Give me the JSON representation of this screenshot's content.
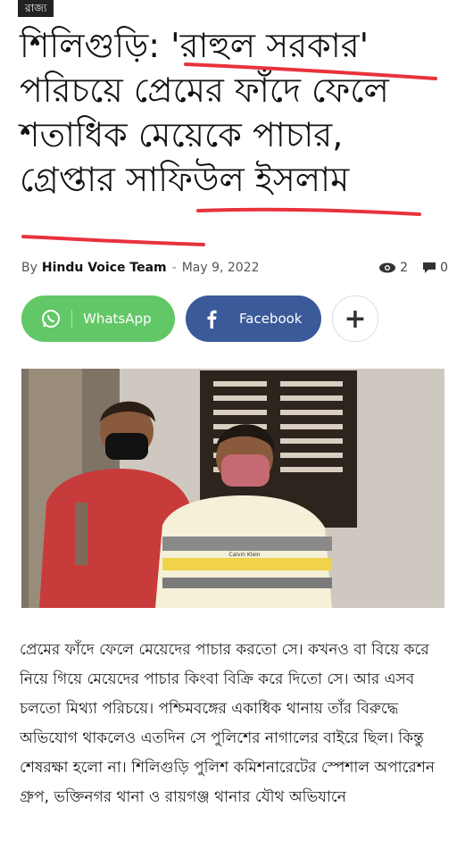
{
  "category": "রাজ্য",
  "title": "শিলিগুড়ি: 'রাহুল সরকার' পরিচয়ে প্রেমের ফাঁদে ফেলে শতাধিক মেয়েকে পাচার, গ্রেপ্তার সাফিউল ইসলাম",
  "meta": {
    "by": "By",
    "author": "Hindu Voice Team",
    "separator": "-",
    "date": "May 9, 2022",
    "views": "2",
    "comments": "0"
  },
  "share": {
    "whatsapp_label": "WhatsApp",
    "facebook_label": "Facebook",
    "more_label": "+"
  },
  "photo": {
    "shirt_brand": "Calvin Klein"
  },
  "article": {
    "body": "প্রেমের ফাঁদে ফেলে মেয়েদের পাচার করতো সে। কখনও বা বিয়ে করে নিয়ে গিয়ে মেয়েদের পাচার কিংবা বিক্রি করে দিতো সে। আর এসব চলতো মিথ্যা পরিচয়ে। পশ্চিমবঙ্গের একাধিক থানায় তাঁর বিরুদ্ধে অভিযোগ থাকলেও এতদিন সে পুলিশের নাগালের বাইরে ছিল। কিন্তু শেষরক্ষা হলো না। শিলিগুড়ি পুলিশ কমিশনারেটের স্পেশাল অপারেশন গ্রুপ, ভক্তিনগর থানা ও রায়গঞ্জ থানার যৌথ অভিযানে"
  },
  "colors": {
    "whatsapp": "#62c766",
    "facebook": "#3b5a9a",
    "underline": "#e8323c"
  }
}
